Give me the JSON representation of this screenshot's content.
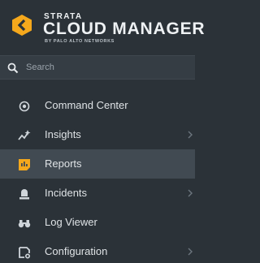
{
  "brand": {
    "line1": "STRATA",
    "line2": "CLOUD MANAGER",
    "line3": "BY PALO ALTO NETWORKS",
    "logo_color": "#f5a81c"
  },
  "search": {
    "placeholder": "Search"
  },
  "nav": {
    "items": [
      {
        "label": "Command Center",
        "icon": "target-icon",
        "has_chevron": false
      },
      {
        "label": "Insights",
        "icon": "insights-icon",
        "has_chevron": true
      },
      {
        "label": "Reports",
        "icon": "reports-icon",
        "has_chevron": false,
        "active": true,
        "icon_color": "#f5a81c"
      },
      {
        "label": "Incidents",
        "icon": "alarm-icon",
        "has_chevron": true
      },
      {
        "label": "Log Viewer",
        "icon": "binoculars-icon",
        "has_chevron": false
      },
      {
        "label": "Configuration",
        "icon": "config-icon",
        "has_chevron": true
      }
    ]
  }
}
